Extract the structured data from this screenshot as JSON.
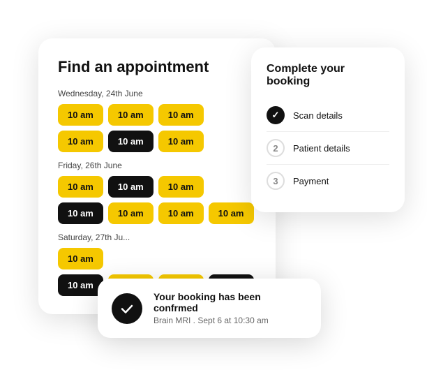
{
  "appointmentCard": {
    "title": "Find an appointment",
    "dates": [
      {
        "label": "Wednesday, 24th June",
        "rows": [
          [
            {
              "time": "10 am",
              "style": "yellow"
            },
            {
              "time": "10 am",
              "style": "yellow"
            },
            {
              "time": "10 am",
              "style": "yellow"
            }
          ],
          [
            {
              "time": "10 am",
              "style": "yellow"
            },
            {
              "time": "10 am",
              "style": "black"
            },
            {
              "time": "10 am",
              "style": "yellow"
            }
          ]
        ]
      },
      {
        "label": "Friday, 26th June",
        "rows": [
          [
            {
              "time": "10 am",
              "style": "yellow"
            },
            {
              "time": "10 am",
              "style": "black"
            },
            {
              "time": "10 am",
              "style": "yellow"
            }
          ],
          [
            {
              "time": "10 am",
              "style": "black"
            },
            {
              "time": "10 am",
              "style": "yellow"
            },
            {
              "time": "10 am",
              "style": "yellow"
            },
            {
              "time": "10 am",
              "style": "yellow"
            }
          ]
        ]
      },
      {
        "label": "Saturday, 27th Ju...",
        "rows": [
          [
            {
              "time": "10 am",
              "style": "yellow"
            }
          ],
          [
            {
              "time": "10 am",
              "style": "black"
            },
            {
              "time": "10 am",
              "style": "yellow"
            },
            {
              "time": "10 am",
              "style": "yellow"
            },
            {
              "time": "10 am",
              "style": "black"
            }
          ]
        ]
      }
    ]
  },
  "bookingCard": {
    "title": "Complete your booking",
    "steps": [
      {
        "number": "✓",
        "label": "Scan details",
        "status": "done"
      },
      {
        "number": "2",
        "label": "Patient details",
        "status": "pending"
      },
      {
        "number": "3",
        "label": "Payment",
        "status": "pending"
      }
    ]
  },
  "toast": {
    "title": "Your booking has been confrmed",
    "subtitle": "Brain MRI . Sept 6 at 10:30 am"
  }
}
